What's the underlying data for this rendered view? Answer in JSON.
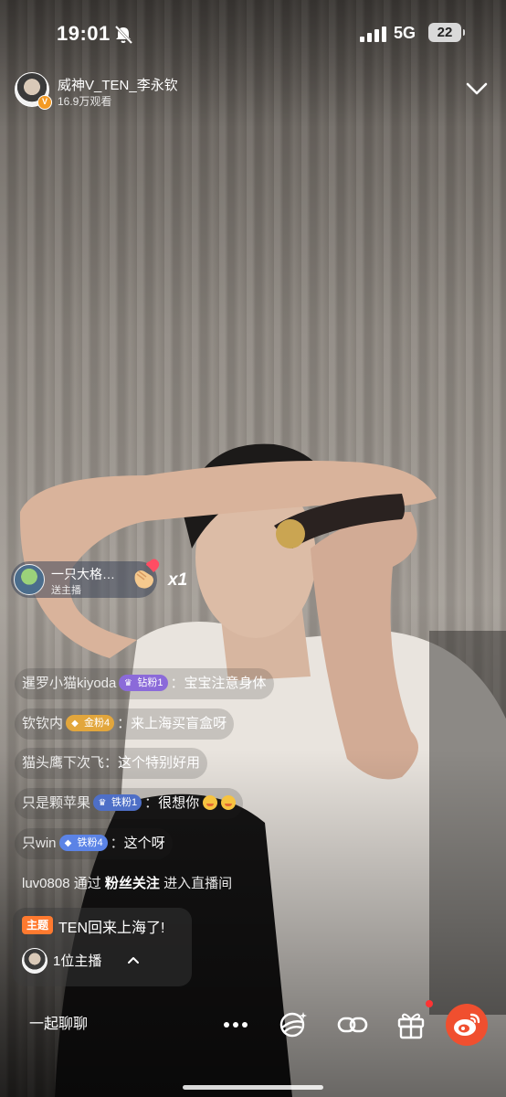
{
  "status_bar": {
    "time": "19:01",
    "network": "5G",
    "battery": "22",
    "icons": [
      "bell-off-icon",
      "signal-icon"
    ]
  },
  "host": {
    "name": "威神V_TEN_李永钦",
    "viewers": "16.9万观看",
    "badge": "V"
  },
  "gift": {
    "user": "一只大格…",
    "action": "送主播",
    "count": "x1",
    "icon": "heart-hand-icon"
  },
  "chat": [
    {
      "user": "暹罗小猫kiyoda",
      "badge": "钻粉1",
      "badge_icon": "♛",
      "badge_color": "#8b6ad9",
      "message": "宝宝注意身体",
      "emoji": 0
    },
    {
      "user": "钦钦内",
      "badge": "金粉4",
      "badge_icon": "◆",
      "badge_color": "#e2a63c",
      "message": "来上海买盲盒呀",
      "emoji": 0
    },
    {
      "user": "猫头鹰下次飞",
      "badge": "",
      "message": "这个特别好用",
      "emoji": 0
    },
    {
      "user": "只是颗苹果",
      "badge": "铁粉1",
      "badge_icon": "♛",
      "badge_color": "#4e6fc7",
      "message": "很想你",
      "emoji": 2
    },
    {
      "user": "只win",
      "badge": "铁粉4",
      "badge_icon": "◆",
      "badge_color": "#5b83e6",
      "message": "这个呀",
      "emoji": 0
    }
  ],
  "enter_notice": {
    "user": "luv0808",
    "via": "通过",
    "source": "粉丝关注",
    "action": "进入直播间"
  },
  "topic": {
    "tag": "主题",
    "title": "TEN回来上海了!",
    "hosts": "1位主播"
  },
  "bottom_bar": {
    "chat_placeholder": "一起聊聊",
    "buttons": [
      "more-icon",
      "bobble-icon",
      "link-icon",
      "gift-icon",
      "weibo-icon"
    ]
  }
}
